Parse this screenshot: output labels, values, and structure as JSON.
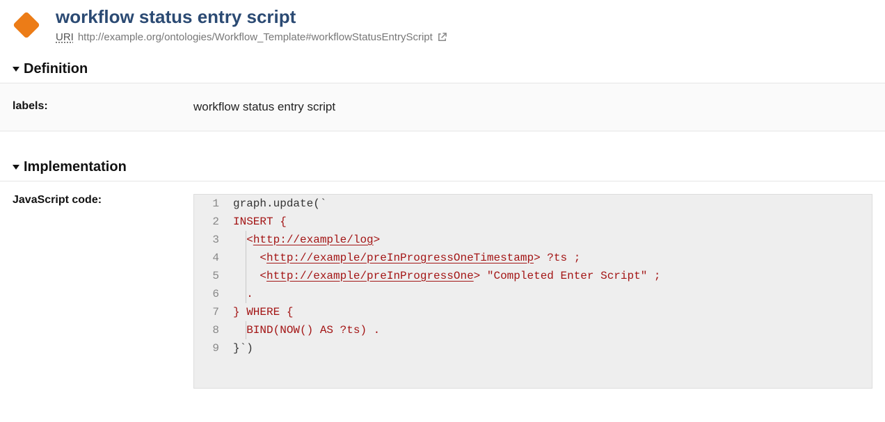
{
  "header": {
    "title": "workflow status entry script",
    "uri_label": "URI",
    "uri_value": "http://example.org/ontologies/Workflow_Template#workflowStatusEntryScript"
  },
  "sections": {
    "definition": {
      "heading": "Definition",
      "labels_label": "labels:",
      "labels_value": "workflow status entry script"
    },
    "implementation": {
      "heading": "Implementation",
      "code_label": "JavaScript code:"
    }
  },
  "code": {
    "line1_a": "graph.update(`",
    "line2_a": "INSERT",
    "line2_b": " {",
    "line3_a": "  <",
    "line3_b": "http://example/log",
    "line3_c": ">",
    "line4_a": "    <",
    "line4_b": "http://example/preInProgressOneTimestamp",
    "line4_c": "> ?ts ;",
    "line5_a": "    <",
    "line5_b": "http://example/preInProgressOne",
    "line5_c": "> ",
    "line5_d": "\"Completed Enter Script\"",
    "line5_e": " ;",
    "line6_a": "  .",
    "line7_a": "} ",
    "line7_b": "WHERE",
    "line7_c": " {",
    "line8_a": "  BIND(NOW() ",
    "line8_b": "AS",
    "line8_c": " ?ts) .",
    "line9_a": "}`)"
  },
  "linenos": {
    "l1": "1",
    "l2": "2",
    "l3": "3",
    "l4": "4",
    "l5": "5",
    "l6": "6",
    "l7": "7",
    "l8": "8",
    "l9": "9"
  }
}
